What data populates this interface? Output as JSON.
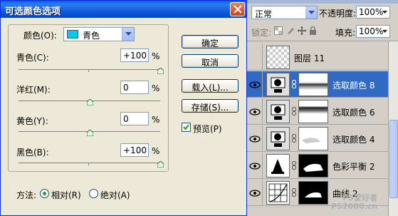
{
  "dialog": {
    "title": "可选颜色选项",
    "color_label": "颜色(O):",
    "color_value": "青色",
    "sliders": [
      {
        "label": "青色(C):",
        "value": "+100",
        "unit": "%",
        "fraction": 1.0
      },
      {
        "label": "洋红(M):",
        "value": "0",
        "unit": "%",
        "fraction": 0.5
      },
      {
        "label": "黄色(Y):",
        "value": "0",
        "unit": "%",
        "fraction": 0.5
      },
      {
        "label": "黑色(B):",
        "value": "+100",
        "unit": "%",
        "fraction": 1.0
      }
    ],
    "buttons": {
      "ok": "确定",
      "cancel": "取消",
      "load": "载入(L)...",
      "save": "存储(S)..."
    },
    "preview_label": "预览(P)",
    "preview_checked": true,
    "method_label": "方法:",
    "method_relative": "相对(R)",
    "method_absolute": "绝对(A)",
    "method_selected": "relative"
  },
  "layers_panel": {
    "blend_mode": "正常",
    "opacity_label": "不透明度:",
    "opacity_value": "100%",
    "lock_label": "锁定:",
    "fill_label": "填充:",
    "fill_value": "100%",
    "layers": [
      {
        "name": "图层 11",
        "visible": false,
        "selected": false,
        "kind": "raster"
      },
      {
        "name": "选取颜色 8",
        "visible": true,
        "selected": true,
        "kind": "adjust"
      },
      {
        "name": "选取颜色 6",
        "visible": true,
        "selected": false,
        "kind": "adjust"
      },
      {
        "name": "选取颜色 4",
        "visible": true,
        "selected": false,
        "kind": "adjust"
      },
      {
        "name": "色彩平衡 2",
        "visible": true,
        "selected": false,
        "kind": "balance"
      },
      {
        "name": "曲线 2",
        "visible": true,
        "selected": false,
        "kind": "curves"
      }
    ]
  },
  "watermark": {
    "line1": "PS爱好者",
    "line2": "PS2000.cn"
  },
  "colors": {
    "title_bar": "#0a56d8",
    "dialog_bg": "#ece9d8",
    "selected_row": "#316ac5",
    "swatch_cyan": "#00c8f0"
  }
}
